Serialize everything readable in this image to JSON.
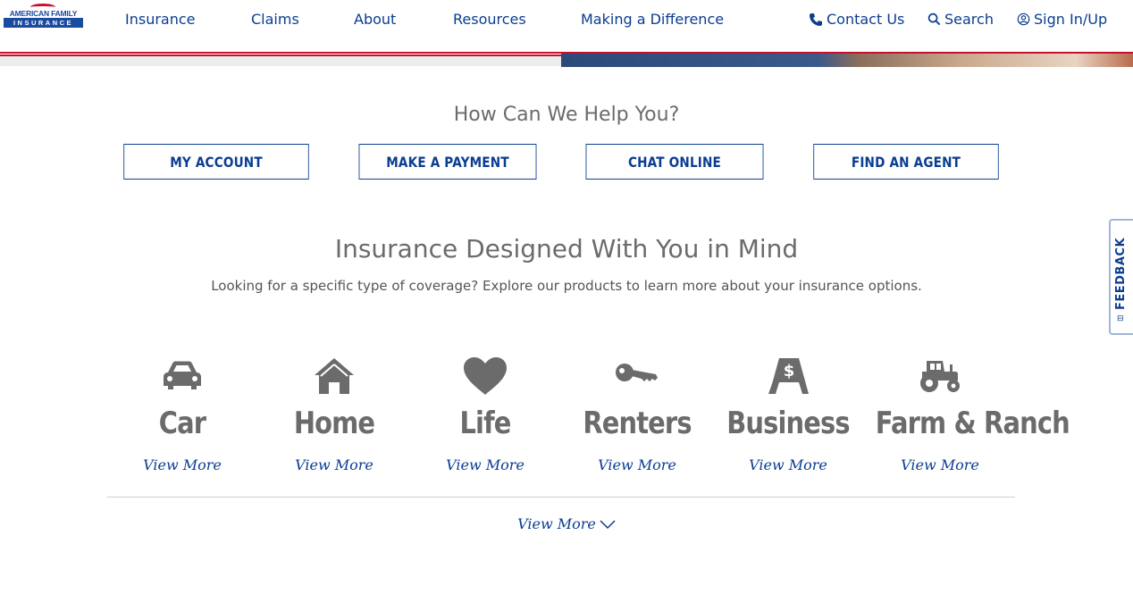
{
  "header": {
    "logo": {
      "top_text": "AMERICAN FAMILY",
      "bar_text": "INSURANCE"
    },
    "nav": [
      "Insurance",
      "Claims",
      "About",
      "Resources",
      "Making a Difference"
    ],
    "utility": {
      "contact": "Contact Us",
      "search": "Search",
      "signin": "Sign In/Up"
    }
  },
  "help": {
    "title": "How Can We Help You?",
    "buttons": [
      "MY ACCOUNT",
      "MAKE A PAYMENT",
      "CHAT ONLINE",
      "FIND AN AGENT"
    ]
  },
  "insurance": {
    "title": "Insurance Designed With You in Mind",
    "subtitle": "Looking for a specific type of coverage? Explore our products to learn more about your insurance options.",
    "products": [
      {
        "name": "Car",
        "icon": "car-icon",
        "more": "View More"
      },
      {
        "name": "Home",
        "icon": "house-icon",
        "more": "View More"
      },
      {
        "name": "Life",
        "icon": "heart-icon",
        "more": "View More"
      },
      {
        "name": "Renters",
        "icon": "key-icon",
        "more": "View More"
      },
      {
        "name": "Business",
        "icon": "sandwich-board-icon",
        "more": "View More"
      },
      {
        "name": "Farm & Ranch",
        "icon": "tractor-icon",
        "more": "View More"
      }
    ],
    "view_more": "View More"
  },
  "feedback": {
    "label": "FEEDBACK"
  },
  "colors": {
    "brand_blue": "#0b3d91",
    "brand_red": "#c8102e",
    "icon_gray": "#6b6b6b"
  }
}
